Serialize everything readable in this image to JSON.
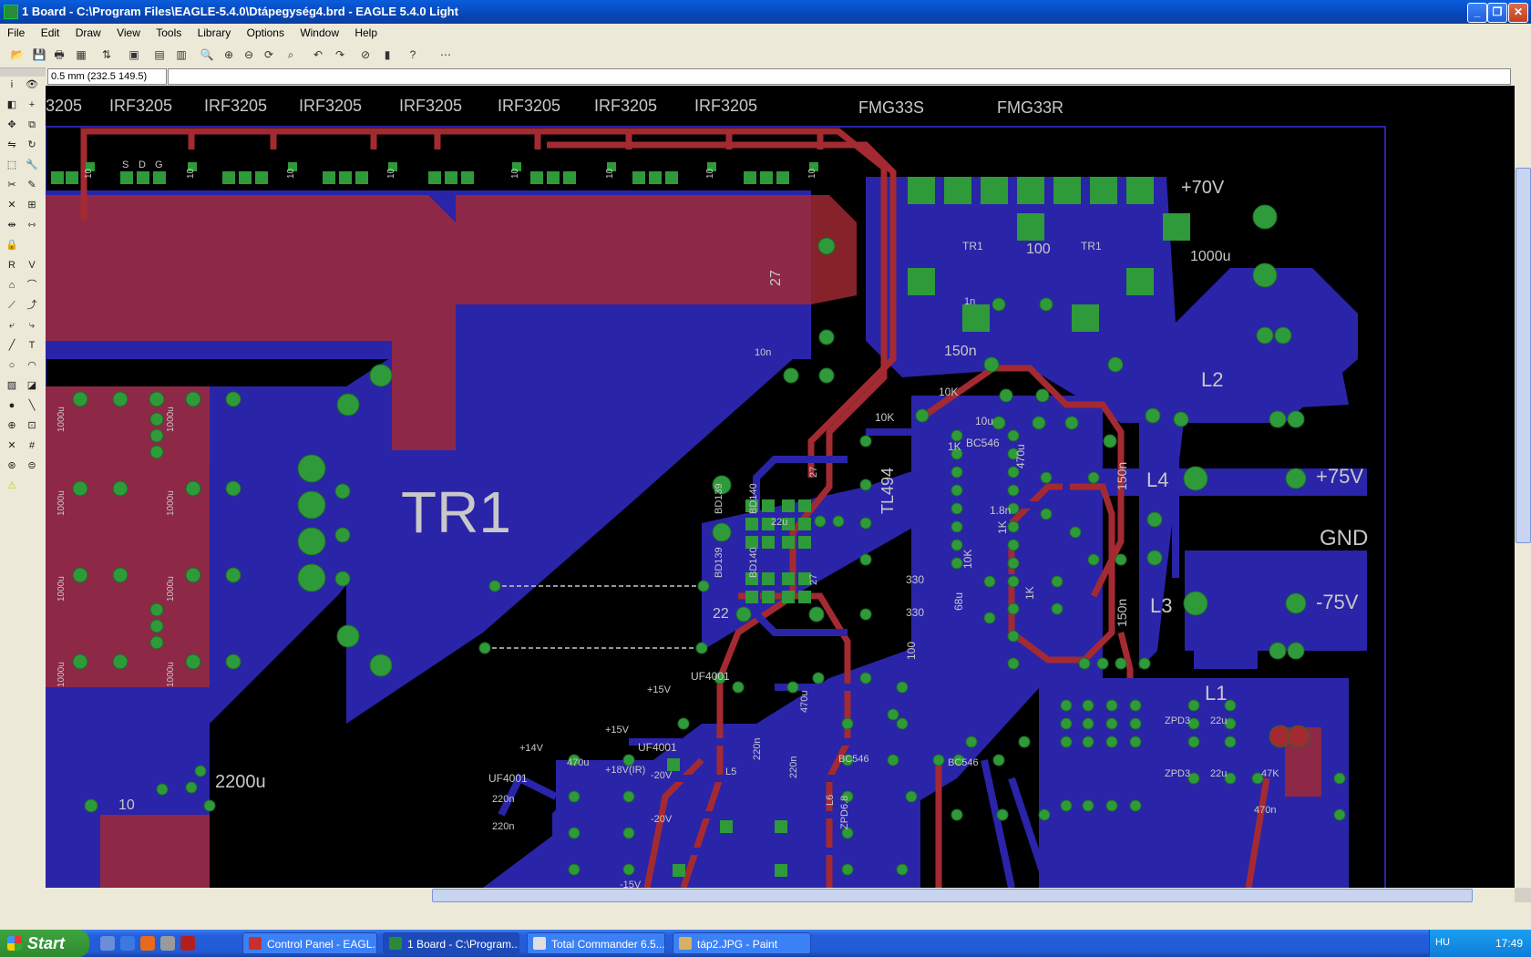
{
  "window": {
    "title": "1 Board - C:\\Program Files\\EAGLE-5.4.0\\Dtápegység4.brd - EAGLE 5.4.0 Light",
    "controls": [
      "_",
      "❐",
      "✕"
    ]
  },
  "menu": [
    "File",
    "Edit",
    "Draw",
    "View",
    "Tools",
    "Library",
    "Options",
    "Window",
    "Help"
  ],
  "coordinates": "0.5 mm (232.5 149.5)",
  "board": {
    "top_labels": [
      "3205",
      "IRF3205",
      "IRF3205",
      "IRF3205",
      "IRF3205",
      "IRF3205",
      "IRF3205",
      "IRF3205"
    ],
    "fmg_labels": [
      "FMG33S",
      "FMG33R"
    ],
    "big_label": "TR1",
    "power_labels": [
      "+70V",
      "1000u",
      "L2",
      "L4",
      "+75V",
      "GND",
      "L3",
      "-75V",
      "L1"
    ],
    "component_labels": [
      "150n",
      "10K",
      "10K",
      "10u",
      "1K",
      "BC546",
      "470u",
      "TL494",
      "1.8n",
      "1K",
      "10K",
      "330",
      "330",
      "68u",
      "1K",
      "100",
      "22",
      "BD139",
      "BD140",
      "BD139",
      "BD140",
      "22u",
      "27",
      "27",
      "27",
      "10n",
      "1n",
      "100",
      "TR1",
      "TR1",
      "UF4001",
      "UF4001",
      "UF4001",
      "+15V",
      "+15V",
      "-15V",
      "+14V",
      "470u",
      "470u",
      "+18V(IR)",
      "-20V",
      "-20V",
      "220n",
      "220n",
      "220n",
      "220n",
      "ZPD3",
      "ZPD3",
      "22u",
      "22u",
      "47K",
      "470n",
      "BC546",
      "BC546",
      "2200u",
      "10",
      "150n",
      "150n",
      "L5",
      "L6",
      "ZPD6.8"
    ],
    "rotated_labels": [
      "1000u",
      "1000u",
      "1000u",
      "1000u",
      "1000u",
      "1000u",
      "1000u",
      "1000u",
      "10",
      "10",
      "10",
      "10",
      "10",
      "10",
      "10",
      "10"
    ],
    "pin_labels": [
      "S",
      "D",
      "G"
    ]
  },
  "taskbar": {
    "start": "Start",
    "tasks": [
      "Control Panel - EAGL...",
      "1 Board - C:\\Program...",
      "Total Commander 6.5...",
      "táp2.JPG - Paint"
    ],
    "lang": "HU",
    "clock": "17:49"
  },
  "colors": {
    "copper_bottom": "#2a24a8",
    "copper_top": "#a42a32",
    "pad": "#2f9a3a",
    "silkscreen": "#c8c8c8",
    "board_bg": "#000000",
    "titlebar": "#0a5ddc"
  }
}
